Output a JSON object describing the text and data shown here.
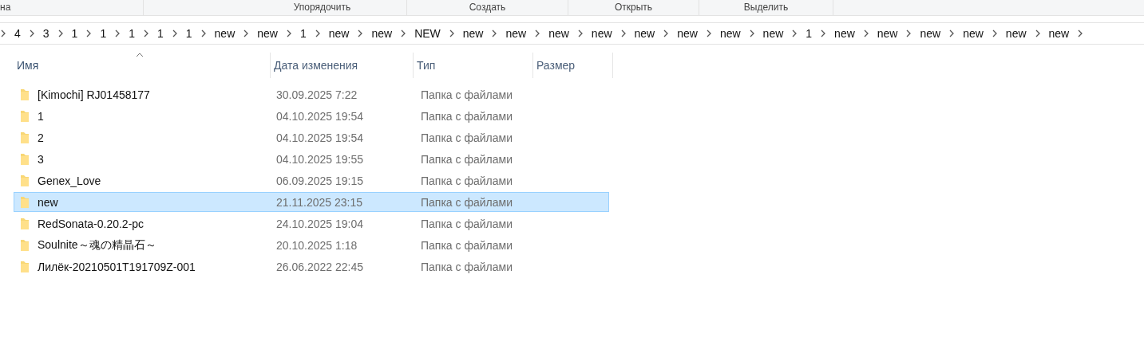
{
  "ribbon_groups": [
    "на",
    "Упорядочить",
    "Создать",
    "Открыть",
    "Выделить"
  ],
  "breadcrumb": [
    "4",
    "3",
    "1",
    "1",
    "1",
    "1",
    "1",
    "new",
    "new",
    "1",
    "new",
    "new",
    "NEW",
    "new",
    "new",
    "new",
    "new",
    "new",
    "new",
    "new",
    "new",
    "1",
    "new",
    "new",
    "new",
    "new",
    "new",
    "new"
  ],
  "columns": [
    {
      "label": "Имя",
      "sorted": true
    },
    {
      "label": "Дата изменения",
      "sorted": false
    },
    {
      "label": "Тип",
      "sorted": false
    },
    {
      "label": "Размер",
      "sorted": false
    }
  ],
  "rows": [
    {
      "name": "[Kimochi] RJ01458177",
      "date": "30.09.2025 7:22",
      "type": "Папка с файлами",
      "selected": false
    },
    {
      "name": "1",
      "date": "04.10.2025 19:54",
      "type": "Папка с файлами",
      "selected": false
    },
    {
      "name": "2",
      "date": "04.10.2025 19:54",
      "type": "Папка с файлами",
      "selected": false
    },
    {
      "name": "3",
      "date": "04.10.2025 19:55",
      "type": "Папка с файлами",
      "selected": false
    },
    {
      "name": "Genex_Love",
      "date": "06.09.2025 19:15",
      "type": "Папка с файлами",
      "selected": false
    },
    {
      "name": "new",
      "date": "21.11.2025 23:15",
      "type": "Папка с файлами",
      "selected": true
    },
    {
      "name": "RedSonata-0.20.2-pc",
      "date": "24.10.2025 19:04",
      "type": "Папка с файлами",
      "selected": false
    },
    {
      "name": "Soulnite～魂の精晶石～",
      "date": "20.10.2025 1:18",
      "type": "Папка с файлами",
      "selected": false
    },
    {
      "name": "Лилёк-20210501T191709Z-001",
      "date": "26.06.2022 22:45",
      "type": "Папка с файлами",
      "selected": false
    }
  ]
}
